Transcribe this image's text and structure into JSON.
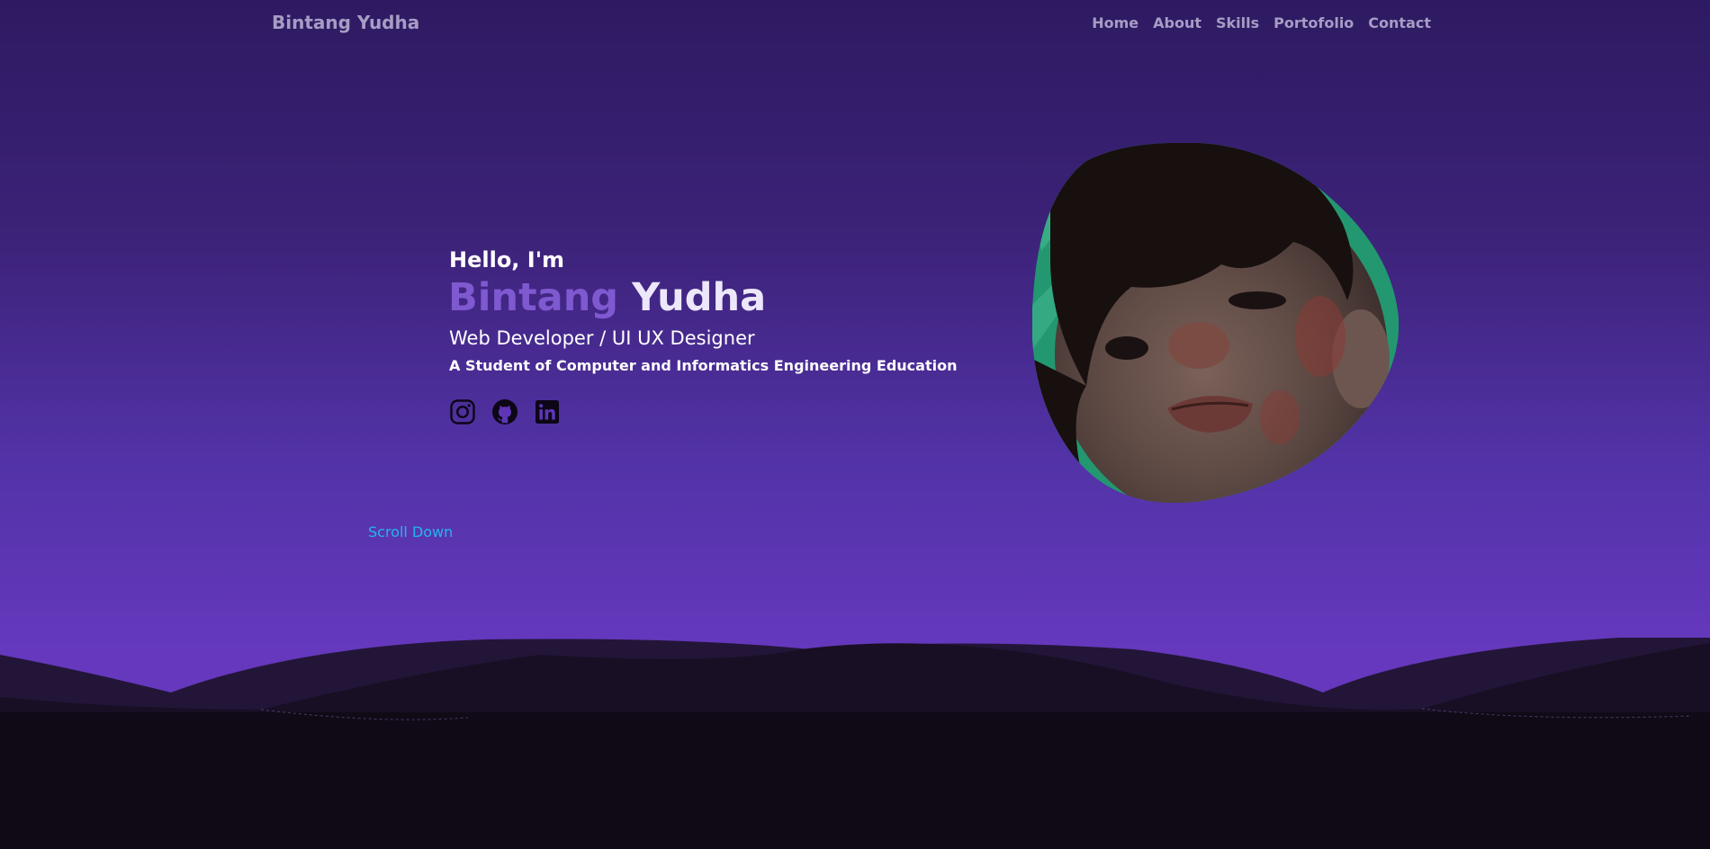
{
  "nav": {
    "brand": "Bintang Yudha",
    "links": [
      {
        "label": "Home"
      },
      {
        "label": "About"
      },
      {
        "label": "Skills"
      },
      {
        "label": "Portofolio"
      },
      {
        "label": "Contact"
      }
    ]
  },
  "hero": {
    "greeting": "Hello, I'm",
    "name_first": "Bintang",
    "name_last": "Yudha",
    "role": "Web Developer / UI UX Designer",
    "subtitle": "A Student of Computer and Informatics Engineering Education",
    "socials": [
      {
        "icon": "instagram-icon"
      },
      {
        "icon": "github-icon"
      },
      {
        "icon": "linkedin-icon"
      }
    ],
    "scroll_label": "Scroll Down"
  },
  "colors": {
    "gradient_top": "#2e1a62",
    "gradient_bottom": "#6538bd",
    "nav_text": "#a79cc4",
    "name_first": "#7e59cf",
    "name_last": "#ede7fb",
    "scroll_link": "#22b7ea",
    "footer_dark": "#100a17"
  }
}
